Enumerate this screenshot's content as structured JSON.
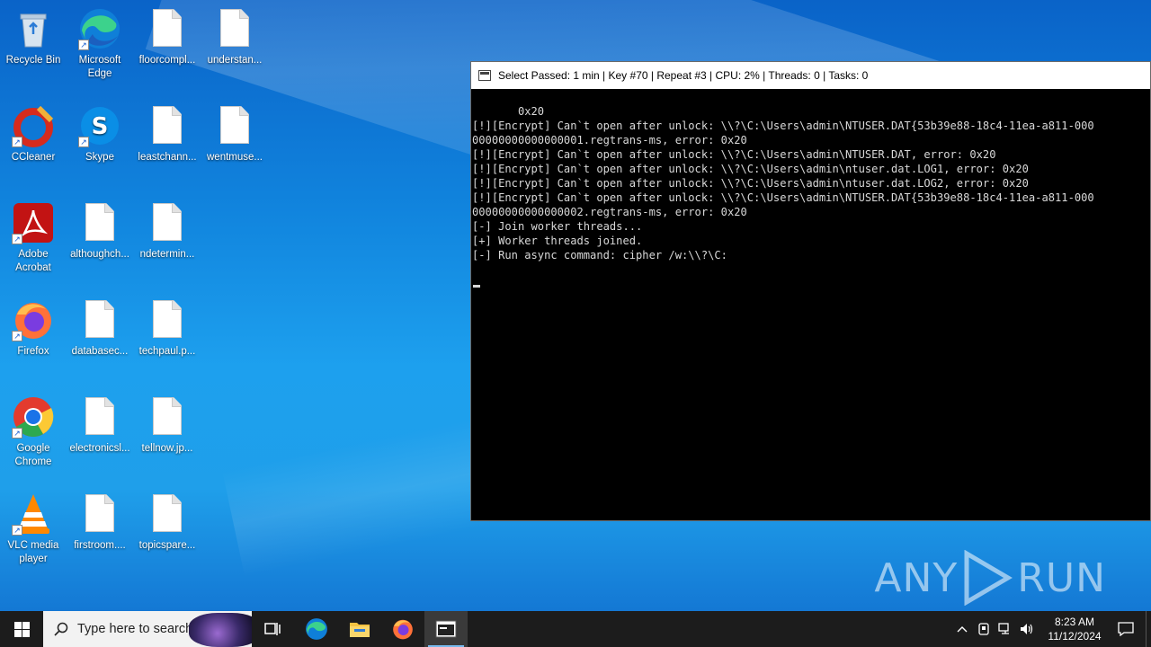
{
  "desktop": {
    "icons": [
      {
        "label": "Recycle Bin",
        "icon": "recycle-bin-icon"
      },
      {
        "label": "Microsoft Edge",
        "icon": "edge-icon"
      },
      {
        "label": "floorcompl...",
        "icon": "file-icon"
      },
      {
        "label": "understan...",
        "icon": "file-icon"
      },
      {
        "label": "CCleaner",
        "icon": "ccleaner-icon"
      },
      {
        "label": "Skype",
        "icon": "skype-icon"
      },
      {
        "label": "leastchann...",
        "icon": "file-icon"
      },
      {
        "label": "wentmuse...",
        "icon": "file-icon"
      },
      {
        "label": "Adobe Acrobat",
        "icon": "acrobat-icon"
      },
      {
        "label": "althoughch...",
        "icon": "file-icon"
      },
      {
        "label": "ndetermin...",
        "icon": "file-icon"
      },
      {
        "label": "Firefox",
        "icon": "firefox-icon"
      },
      {
        "label": "databasec...",
        "icon": "file-icon"
      },
      {
        "label": "techpaul.p...",
        "icon": "file-icon"
      },
      {
        "label": "Google Chrome",
        "icon": "chrome-icon"
      },
      {
        "label": "electronicsl...",
        "icon": "file-icon"
      },
      {
        "label": "tellnow.jp...",
        "icon": "file-icon"
      },
      {
        "label": "VLC media player",
        "icon": "vlc-icon"
      },
      {
        "label": "firstroom....",
        "icon": "file-icon"
      },
      {
        "label": "topicspare...",
        "icon": "file-icon"
      }
    ]
  },
  "console": {
    "title": "Select Passed: 1 min | Key #70 | Repeat #3 | CPU: 2% | Threads: 0 | Tasks: 0",
    "output": " 0x20\n[!][Encrypt] Can`t open after unlock: \\\\?\\C:\\Users\\admin\\NTUSER.DAT{53b39e88-18c4-11ea-a811-000\n00000000000000001.regtrans-ms, error: 0x20\n[!][Encrypt] Can`t open after unlock: \\\\?\\C:\\Users\\admin\\NTUSER.DAT, error: 0x20\n[!][Encrypt] Can`t open after unlock: \\\\?\\C:\\Users\\admin\\ntuser.dat.LOG1, error: 0x20\n[!][Encrypt] Can`t open after unlock: \\\\?\\C:\\Users\\admin\\ntuser.dat.LOG2, error: 0x20\n[!][Encrypt] Can`t open after unlock: \\\\?\\C:\\Users\\admin\\NTUSER.DAT{53b39e88-18c4-11ea-a811-000\n00000000000000002.regtrans-ms, error: 0x20\n[-] Join worker threads...\n[+] Worker threads joined.\n[-] Run async command: cipher /w:\\\\?\\C:"
  },
  "watermark": {
    "left": "ANY",
    "right": "RUN"
  },
  "taskbar": {
    "search_placeholder": "Type here to search",
    "time": "8:23 AM",
    "date": "11/12/2024"
  }
}
